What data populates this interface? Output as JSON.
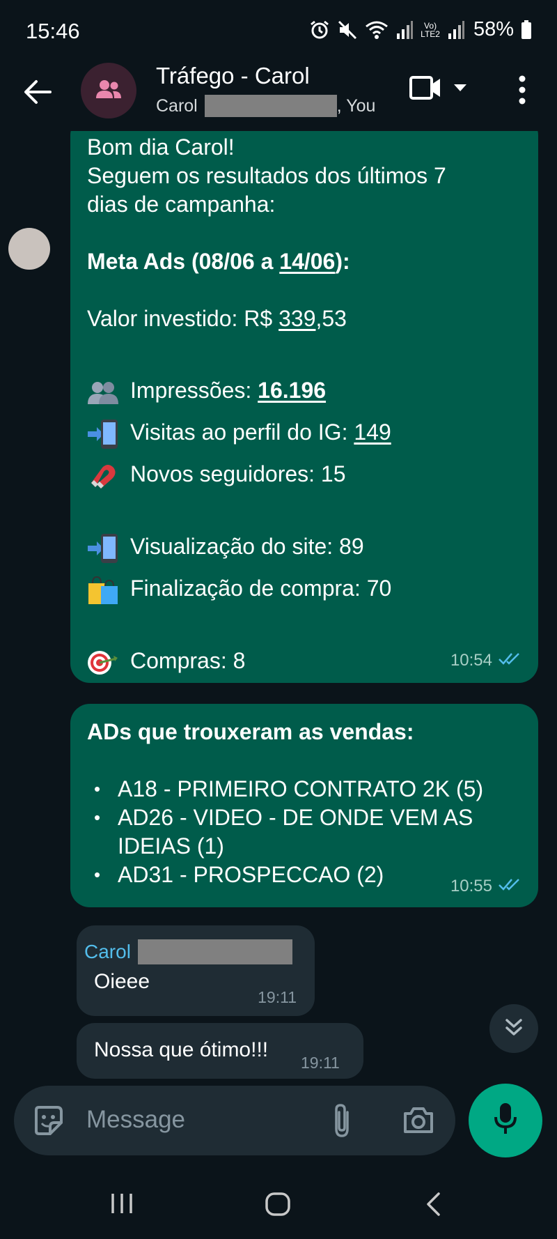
{
  "status_bar": {
    "time": "15:46",
    "battery": "58%",
    "network_label": "LTE2"
  },
  "header": {
    "title": "Tráfego - Carol",
    "subtitle_prefix": "Carol",
    "subtitle_suffix": ", You"
  },
  "messages": {
    "msg1": {
      "greeting": "Bom dia Carol!",
      "intro_1": "Seguem os resultados dos últimos 7",
      "intro_2": "dias de campanha:",
      "heading_prefix": "Meta Ads (08/06 a ",
      "heading_date": "14/06",
      "heading_suffix": "):",
      "invest_prefix": "Valor investido: R$ ",
      "invest_value_main": "339",
      "invest_value_cents": ",53",
      "impressions_label": "Impressões: ",
      "impressions_value": "16.196",
      "visits_label": "Visitas ao perfil do IG: ",
      "visits_value": "149",
      "followers": "Novos seguidores: 15",
      "site_views": "Visualização do site: 89",
      "checkout": "Finalização de compra: 70",
      "purchases": "Compras: 8",
      "time": "10:54"
    },
    "msg2": {
      "heading": "ADs que trouxeram as vendas:",
      "items": [
        "A18 - PRIMEIRO CONTRATO 2K (5)",
        "AD26 - VIDEO - DE ONDE VEM AS IDEIAS (1)",
        "AD31 - PROSPECCAO (2)"
      ],
      "item2_line1": "AD26 - VIDEO - DE ONDE VEM AS",
      "item2_line2": "IDEIAS (1)",
      "time": "10:55"
    },
    "msg3": {
      "sender": "Carol",
      "text": "Oieee",
      "time": "19:11"
    },
    "msg4": {
      "text": "Nossa que ótimo!!!",
      "time": "19:11"
    }
  },
  "input": {
    "placeholder": "Message"
  },
  "colors": {
    "background": "#0b141a",
    "outgoing_bubble": "#005c4b",
    "incoming_bubble": "#1f2c34",
    "accent": "#00a884",
    "sender_name": "#53bdeb",
    "read_ticks": "#53bdeb"
  },
  "icons": {
    "status": [
      "alarm-icon",
      "mute-icon",
      "wifi-icon",
      "signal-icon",
      "volte-icon",
      "battery-icon"
    ],
    "header": [
      "back-arrow-icon",
      "group-icon",
      "video-call-icon",
      "chevron-down-icon",
      "more-options-icon"
    ],
    "input": [
      "sticker-icon",
      "attach-icon",
      "camera-icon",
      "mic-icon"
    ],
    "nav": [
      "recent-apps-icon",
      "home-icon",
      "back-icon"
    ]
  }
}
